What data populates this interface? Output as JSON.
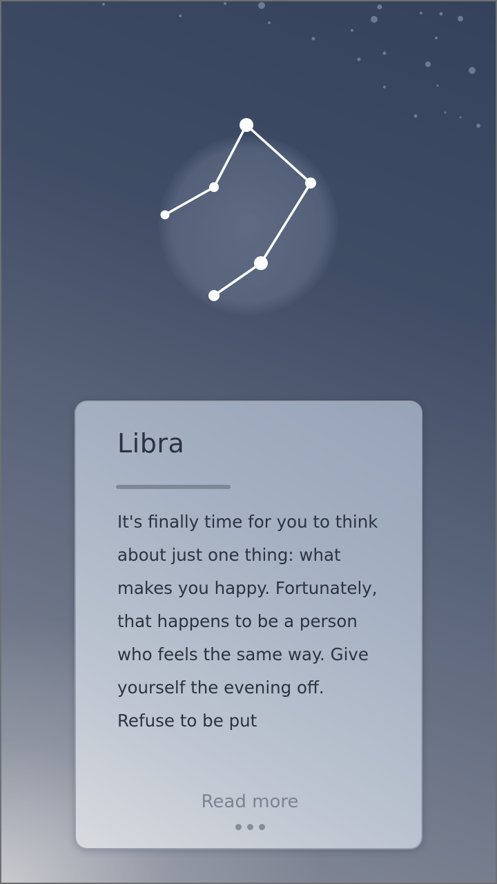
{
  "sign": {
    "name": "Libra",
    "constellation_icon": "libra-constellation-icon"
  },
  "horoscope": {
    "text": "It's finally time for you to think about just one thing: what makes you happy. Fortunately, that happens to be a person who feels the same way. Give yourself the evening off. Refuse to be put"
  },
  "actions": {
    "read_more_label": "Read more",
    "more_icon": "ellipsis-icon"
  },
  "colors": {
    "background_top": "#34425c",
    "background_bottom": "#8a8f9c",
    "card": "#a6b1c3",
    "text": "#2c3340",
    "muted_text": "#7d8390",
    "constellation": "#ffffff"
  }
}
